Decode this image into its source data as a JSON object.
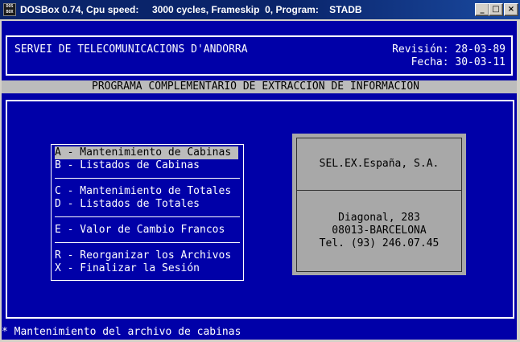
{
  "window": {
    "title": "DOSBox 0.74, Cpu speed:     3000 cycles, Frameskip  0, Program:    STADB",
    "icon_text": [
      "DOS",
      "BOX"
    ],
    "minimize_glyph": "_",
    "maximize_glyph": "□",
    "close_glyph": "×"
  },
  "header": {
    "org_name": "SERVEI DE TELECOMUNICACIONS D'ANDORRA",
    "revision": "Revisión: 28-03-89",
    "date": "Fecha: 30-03-11"
  },
  "program_title": "PROGRAMA COMPLEMENTARIO DE EXTRACCION DE INFORMACION",
  "menu": {
    "items": [
      {
        "key": "A",
        "label": "A - Mantenimiento de Cabinas"
      },
      {
        "key": "B",
        "label": "B - Listados de Cabinas"
      },
      {
        "key": "C",
        "label": "C - Mantenimiento de Totales"
      },
      {
        "key": "D",
        "label": "D - Listados de Totales"
      },
      {
        "key": "E",
        "label": "E - Valor de Cambio Francos"
      },
      {
        "key": "R",
        "label": "R - Reorganizar los Archivos"
      },
      {
        "key": "X",
        "label": "X - Finalizar la Sesión"
      }
    ],
    "selected": "A"
  },
  "company": {
    "name": "SEL.EX.España, S.A.",
    "address_line1": "Diagonal, 283",
    "address_line2": "08013-BARCELONA",
    "phone": "Tel. (93) 246.07.45"
  },
  "status_line": "* Mantenimiento del archivo de cabinas",
  "colors": {
    "dos_background": "#0000a8",
    "dos_foreground": "#ffffff",
    "highlight_background": "#bcbcbc",
    "company_panel": "#a8a8a8",
    "titlebar": "#0a246a"
  }
}
